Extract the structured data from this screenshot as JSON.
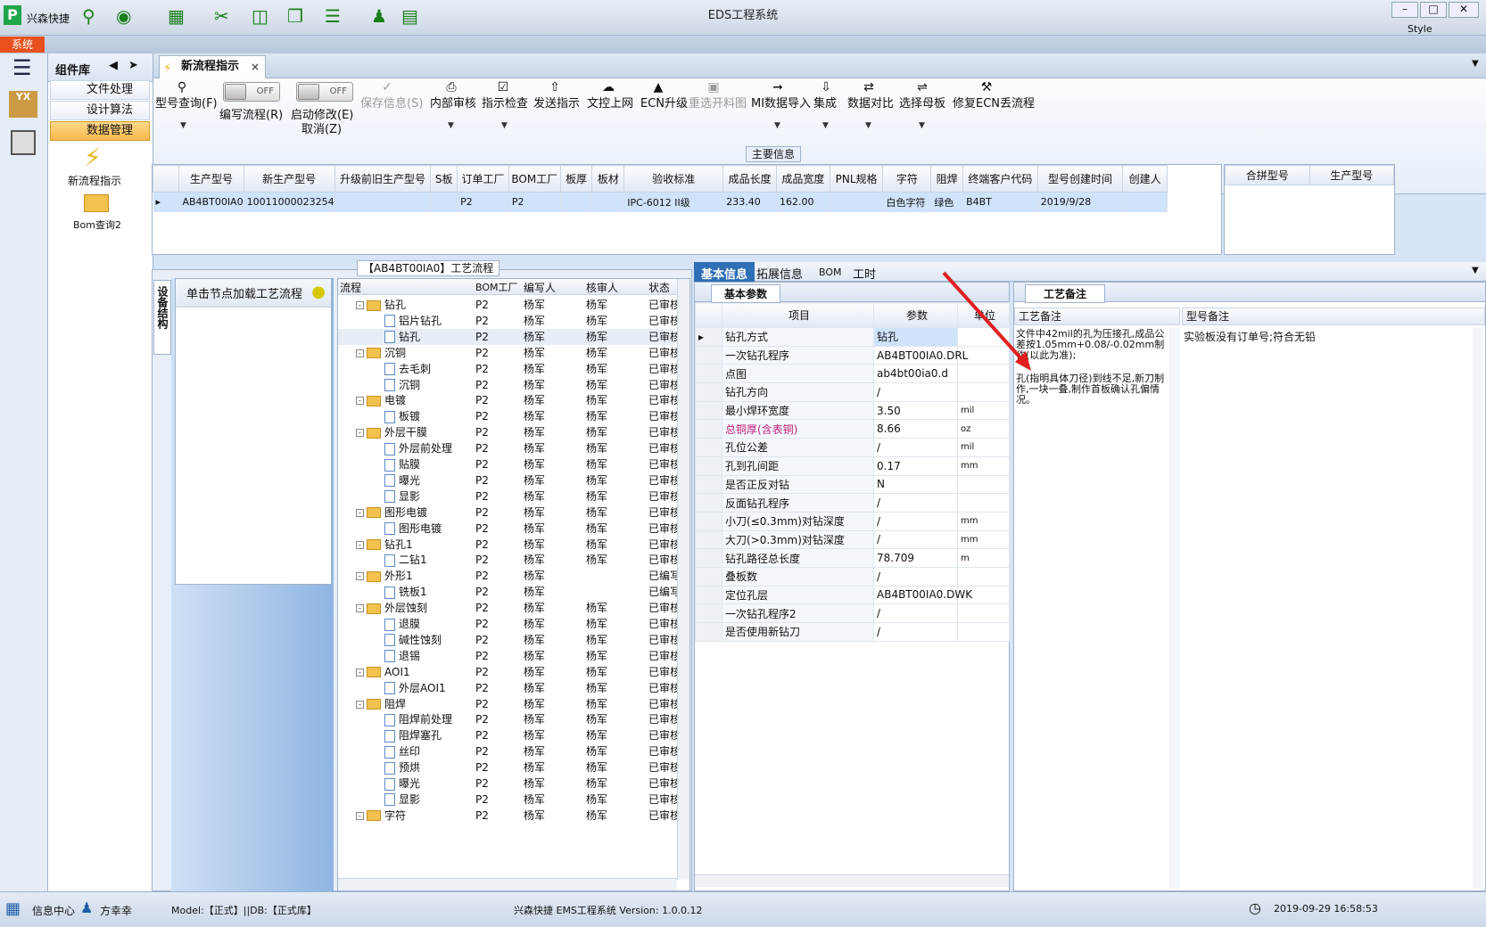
{
  "app": {
    "name": "兴森快捷",
    "title": "EDS工程系统",
    "system_tab": "系统",
    "style_label": "Style"
  },
  "component_lib": {
    "title": "组件库",
    "items": [
      {
        "label": "文件处理"
      },
      {
        "label": "设计算法"
      },
      {
        "label": "数据管理"
      }
    ],
    "tools": [
      {
        "label": "新流程指示"
      },
      {
        "label": "Bom查询2"
      }
    ]
  },
  "doc_tab": {
    "label": "新流程指示"
  },
  "ribbon": {
    "search": "型号查询(F)",
    "write_flow": "编写流程(R)",
    "start_modify": "启动修改(E)",
    "cancel": "取消(Z)",
    "off": "OFF",
    "buttons": [
      "保存信息(S)",
      "内部审核",
      "指示检查",
      "发送指示",
      "文控上网",
      "ECN升级",
      "重选开料图",
      "MI数据导入",
      "集成",
      "数据对比",
      "选择母板",
      "修复ECN丢流程"
    ]
  },
  "main_info": {
    "title": "主要信息",
    "columns": [
      "生产型号",
      "新生产型号",
      "升级前旧生产型号",
      "S板",
      "订单工厂",
      "BOM工厂",
      "板厚",
      "板材",
      "验收标准",
      "成品长度",
      "成品宽度",
      "PNL规格",
      "字符",
      "阻焊",
      "终端客户代码",
      "型号创建时间",
      "创建人"
    ],
    "row": [
      "AB4BT00IA0",
      "10011000023254",
      "",
      "",
      "P2",
      "P2",
      "",
      "",
      "IPC-6012 II级",
      "233.40",
      "162.00",
      "",
      "白色字符",
      "绿色",
      "B4BT",
      "2019/9/28",
      ""
    ],
    "side_columns": [
      "合拼型号",
      "生产型号"
    ]
  },
  "process": {
    "title": "【AB4BT00IA0】工艺流程",
    "side_tab": "设备结构",
    "hint": "单击节点加载工艺流程",
    "columns": [
      "流程",
      "BOM工厂",
      "编写人",
      "核审人",
      "状态"
    ],
    "rows": [
      {
        "name": "钻孔",
        "level": 0,
        "f": "P2",
        "w": "杨军",
        "r": "杨军",
        "s": "已审核"
      },
      {
        "name": "铝片钻孔",
        "level": 1,
        "f": "P2",
        "w": "杨军",
        "r": "杨军",
        "s": "已审核"
      },
      {
        "name": "钻孔",
        "level": 1,
        "f": "P2",
        "w": "杨军",
        "r": "杨军",
        "s": "已审核"
      },
      {
        "name": "沉铜",
        "level": 0,
        "f": "P2",
        "w": "杨军",
        "r": "杨军",
        "s": "已审核"
      },
      {
        "name": "去毛刺",
        "level": 1,
        "f": "P2",
        "w": "杨军",
        "r": "杨军",
        "s": "已审核"
      },
      {
        "name": "沉铜",
        "level": 1,
        "f": "P2",
        "w": "杨军",
        "r": "杨军",
        "s": "已审核"
      },
      {
        "name": "电镀",
        "level": 0,
        "f": "P2",
        "w": "杨军",
        "r": "杨军",
        "s": "已审核"
      },
      {
        "name": "板镀",
        "level": 1,
        "f": "P2",
        "w": "杨军",
        "r": "杨军",
        "s": "已审核"
      },
      {
        "name": "外层干膜",
        "level": 0,
        "f": "P2",
        "w": "杨军",
        "r": "杨军",
        "s": "已审核"
      },
      {
        "name": "外层前处理",
        "level": 1,
        "f": "P2",
        "w": "杨军",
        "r": "杨军",
        "s": "已审核"
      },
      {
        "name": "贴膜",
        "level": 1,
        "f": "P2",
        "w": "杨军",
        "r": "杨军",
        "s": "已审核"
      },
      {
        "name": "曝光",
        "level": 1,
        "f": "P2",
        "w": "杨军",
        "r": "杨军",
        "s": "已审核"
      },
      {
        "name": "显影",
        "level": 1,
        "f": "P2",
        "w": "杨军",
        "r": "杨军",
        "s": "已审核"
      },
      {
        "name": "图形电镀",
        "level": 0,
        "f": "P2",
        "w": "杨军",
        "r": "杨军",
        "s": "已审核"
      },
      {
        "name": "图形电镀",
        "level": 1,
        "f": "P2",
        "w": "杨军",
        "r": "杨军",
        "s": "已审核"
      },
      {
        "name": "钻孔1",
        "level": 0,
        "f": "P2",
        "w": "杨军",
        "r": "杨军",
        "s": "已审核"
      },
      {
        "name": "二钻1",
        "level": 1,
        "f": "P2",
        "w": "杨军",
        "r": "杨军",
        "s": "已审核"
      },
      {
        "name": "外形1",
        "level": 0,
        "f": "P2",
        "w": "杨军",
        "r": "",
        "s": "已编写"
      },
      {
        "name": "铣板1",
        "level": 1,
        "f": "P2",
        "w": "杨军",
        "r": "",
        "s": "已编写"
      },
      {
        "name": "外层蚀刻",
        "level": 0,
        "f": "P2",
        "w": "杨军",
        "r": "杨军",
        "s": "已审核"
      },
      {
        "name": "退膜",
        "level": 1,
        "f": "P2",
        "w": "杨军",
        "r": "杨军",
        "s": "已审核"
      },
      {
        "name": "碱性蚀刻",
        "level": 1,
        "f": "P2",
        "w": "杨军",
        "r": "杨军",
        "s": "已审核"
      },
      {
        "name": "退锡",
        "level": 1,
        "f": "P2",
        "w": "杨军",
        "r": "杨军",
        "s": "已审核"
      },
      {
        "name": "AOI1",
        "level": 0,
        "f": "P2",
        "w": "杨军",
        "r": "杨军",
        "s": "已审核"
      },
      {
        "name": "外层AOI1",
        "level": 1,
        "f": "P2",
        "w": "杨军",
        "r": "杨军",
        "s": "已审核"
      },
      {
        "name": "阻焊",
        "level": 0,
        "f": "P2",
        "w": "杨军",
        "r": "杨军",
        "s": "已审核"
      },
      {
        "name": "阻焊前处理",
        "level": 1,
        "f": "P2",
        "w": "杨军",
        "r": "杨军",
        "s": "已审核"
      },
      {
        "name": "阻焊塞孔",
        "level": 1,
        "f": "P2",
        "w": "杨军",
        "r": "杨军",
        "s": "已审核"
      },
      {
        "name": "丝印",
        "level": 1,
        "f": "P2",
        "w": "杨军",
        "r": "杨军",
        "s": "已审核"
      },
      {
        "name": "预烘",
        "level": 1,
        "f": "P2",
        "w": "杨军",
        "r": "杨军",
        "s": "已审核"
      },
      {
        "name": "曝光",
        "level": 1,
        "f": "P2",
        "w": "杨军",
        "r": "杨军",
        "s": "已审核"
      },
      {
        "name": "显影",
        "level": 1,
        "f": "P2",
        "w": "杨军",
        "r": "杨军",
        "s": "已审核"
      },
      {
        "name": "字符",
        "level": 0,
        "f": "P2",
        "w": "杨军",
        "r": "杨军",
        "s": "已审核"
      }
    ]
  },
  "detail_tabs": [
    "基本信息",
    "拓展信息",
    "BOM",
    "工时"
  ],
  "basic_params": {
    "title": "基本参数",
    "columns": [
      "项目",
      "参数",
      "单位"
    ],
    "rows": [
      {
        "item": "钻孔方式",
        "value": "钻孔",
        "unit": ""
      },
      {
        "item": "一次钻孔程序",
        "value": "AB4BT00IA0.DRL",
        "unit": ""
      },
      {
        "item": "点图",
        "value": "ab4bt00ia0.d",
        "unit": ""
      },
      {
        "item": "钻孔方向",
        "value": "/",
        "unit": ""
      },
      {
        "item": "最小焊环宽度",
        "value": "3.50",
        "unit": "mil"
      },
      {
        "item": "总铜厚(含表铜)",
        "value": "8.66",
        "unit": "oz"
      },
      {
        "item": "孔位公差",
        "value": "/",
        "unit": "mil"
      },
      {
        "item": "孔到孔间距",
        "value": "0.17",
        "unit": "mm"
      },
      {
        "item": "是否正反对钻",
        "value": "N",
        "unit": ""
      },
      {
        "item": "反面钻孔程序",
        "value": "/",
        "unit": ""
      },
      {
        "item": "小刀(≤0.3mm)对钻深度",
        "value": "/",
        "unit": "mm"
      },
      {
        "item": "大刀(>0.3mm)对钻深度",
        "value": "/",
        "unit": "mm"
      },
      {
        "item": "钻孔路径总长度",
        "value": "78.709",
        "unit": "m"
      },
      {
        "item": "叠板数",
        "value": "/",
        "unit": ""
      },
      {
        "item": "定位孔层",
        "value": "AB4BT00IA0.DWK",
        "unit": ""
      },
      {
        "item": "一次钻孔程序2",
        "value": "/",
        "unit": ""
      },
      {
        "item": "是否使用新钻刀",
        "value": "/",
        "unit": ""
      }
    ]
  },
  "process_notes": {
    "title": "工艺备注",
    "col1": "工艺备注",
    "col2": "型号备注",
    "note1a": "文件中42mil的孔为压接孔,成品公差按1.05mm+0.08/-0.02mm制作(以此为准);",
    "note1b": "孔(指明具体刀径)到线不足,新刀制作,一块一叠,制作首板确认孔偏情况。",
    "note2": "实验板没有订单号;符合无铅"
  },
  "status": {
    "info_center": "信息中心",
    "user": "方幸幸",
    "model": "Model:【正式】||DB:【正式库】",
    "version": "兴森快捷 EMS工程系统 Version: 1.0.0.12",
    "datetime": "2019-09-29 16:58:53"
  },
  "colors": {
    "accent": "#2f6fb5",
    "highlight": "#cfe3fb",
    "active_item": "#f6b94a",
    "arrow": "#e02020",
    "pink_label": "#c0207a"
  }
}
